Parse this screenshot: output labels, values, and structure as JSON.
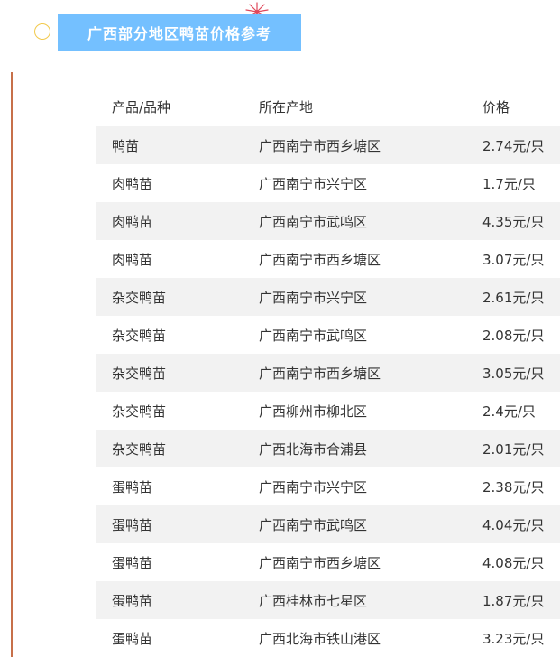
{
  "title": "广西部分地区鸭苗价格参考",
  "colors": {
    "banner": "#74c0ff",
    "accent_line": "#c7704a",
    "circle": "#f2c94c",
    "row_shade": "#f2f2f2"
  },
  "icons": {
    "left": "hollow-circle",
    "top": "firework-sparkle"
  },
  "table": {
    "headers": [
      "产品/品种",
      "所在产地",
      "价格"
    ],
    "rows": [
      [
        "鸭苗",
        "广西南宁市西乡塘区",
        "2.74元/只"
      ],
      [
        "肉鸭苗",
        "广西南宁市兴宁区",
        "1.7元/只"
      ],
      [
        "肉鸭苗",
        "广西南宁市武鸣区",
        "4.35元/只"
      ],
      [
        "肉鸭苗",
        "广西南宁市西乡塘区",
        "3.07元/只"
      ],
      [
        "杂交鸭苗",
        "广西南宁市兴宁区",
        "2.61元/只"
      ],
      [
        "杂交鸭苗",
        "广西南宁市武鸣区",
        "2.08元/只"
      ],
      [
        "杂交鸭苗",
        "广西南宁市西乡塘区",
        "3.05元/只"
      ],
      [
        "杂交鸭苗",
        "广西柳州市柳北区",
        "2.4元/只"
      ],
      [
        "杂交鸭苗",
        "广西北海市合浦县",
        "2.01元/只"
      ],
      [
        "蛋鸭苗",
        "广西南宁市兴宁区",
        "2.38元/只"
      ],
      [
        "蛋鸭苗",
        "广西南宁市武鸣区",
        "4.04元/只"
      ],
      [
        "蛋鸭苗",
        "广西南宁市西乡塘区",
        "4.08元/只"
      ],
      [
        "蛋鸭苗",
        "广西桂林市七星区",
        "1.87元/只"
      ],
      [
        "蛋鸭苗",
        "广西北海市铁山港区",
        "3.23元/只"
      ]
    ]
  }
}
